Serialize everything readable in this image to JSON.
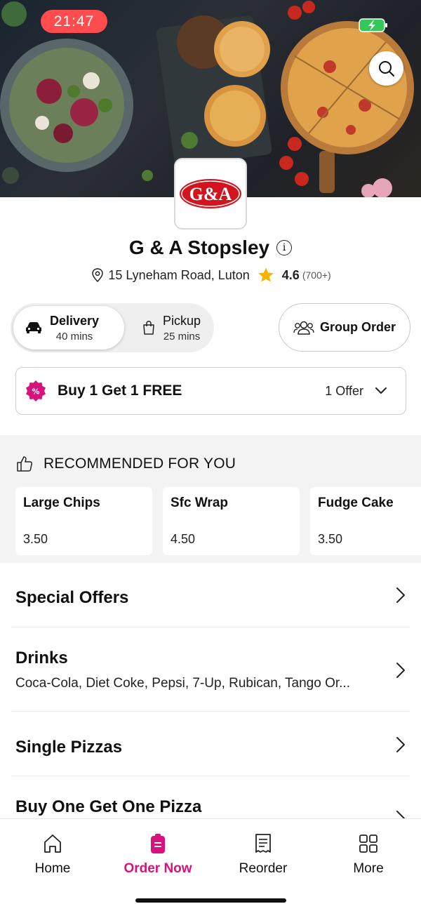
{
  "status_bar": {
    "time": "21:47"
  },
  "store": {
    "logo_text": "G&A",
    "name": "G & A Stopsley",
    "address": "15 Lyneham Road, Luton",
    "rating": "4.6",
    "rating_count": "(700+)"
  },
  "order_mode": {
    "delivery": {
      "label": "Delivery",
      "time": "40 mins"
    },
    "pickup": {
      "label": "Pickup",
      "time": "25 mins"
    },
    "group_order_label": "Group Order"
  },
  "offer": {
    "title": "Buy 1 Get 1 FREE",
    "count": "1 Offer"
  },
  "recommended": {
    "header": "RECOMMENDED FOR YOU",
    "items": [
      {
        "name": "Large Chips",
        "price": "3.50"
      },
      {
        "name": "Sfc Wrap",
        "price": "4.50"
      },
      {
        "name": "Fudge Cake",
        "price": "3.50"
      }
    ]
  },
  "categories": [
    {
      "title": "Special Offers",
      "subtitle": ""
    },
    {
      "title": "Drinks",
      "subtitle": "Coca-Cola, Diet Coke, Pepsi, 7-Up, Rubican, Tango Or..."
    },
    {
      "title": "Single Pizzas",
      "subtitle": ""
    },
    {
      "title": "Buy One Get One Pizza",
      "subtitle": ""
    }
  ],
  "bottom_nav": [
    {
      "label": "Home",
      "icon": "home-icon"
    },
    {
      "label": "Order Now",
      "icon": "order-icon"
    },
    {
      "label": "Reorder",
      "icon": "receipt-icon"
    },
    {
      "label": "More",
      "icon": "grid-icon"
    }
  ],
  "colors": {
    "accent": "#d6137d",
    "time_pill": "#ff4d4f",
    "star": "#f5b400",
    "logo_red": "#d3141e"
  }
}
